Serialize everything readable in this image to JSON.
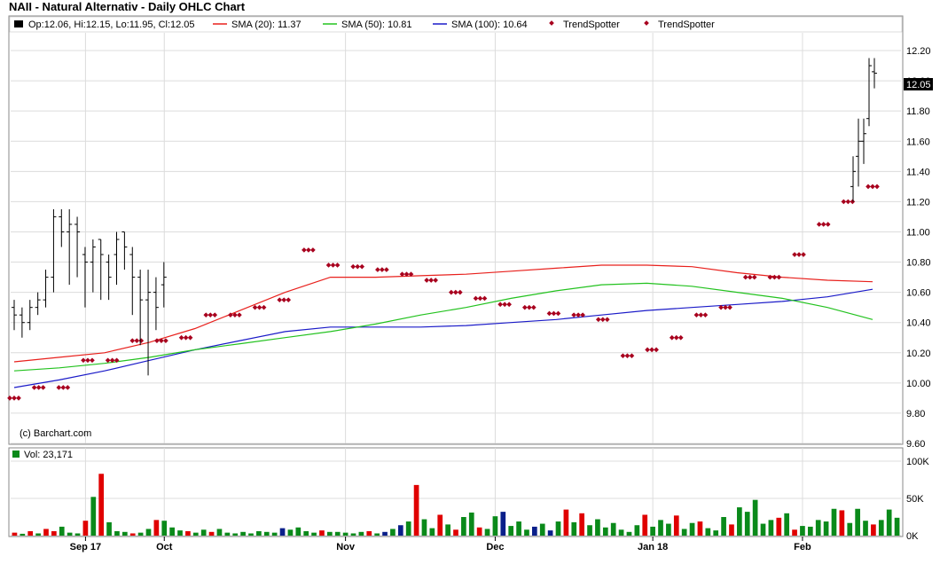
{
  "title": "NAII - Natural Alternativ - Daily OHLC Chart",
  "credit": "(c) Barchart.com",
  "colors": {
    "price_bar": "#000000",
    "sma20": "#e8201c",
    "sma50": "#23c21f",
    "sma100": "#1a1ac8",
    "trendspotter": "#a8001e",
    "vol_up": "#0a8a1a",
    "vol_down": "#e00000",
    "vol_neutral": "#0a1f8a",
    "grid": "#dcdcdc",
    "last_price_bg": "#000000"
  },
  "legend": {
    "ohlc": "Op:12.06, Hi:12.15, Lo:11.95, Cl:12.05",
    "sma20": "SMA (20): 11.37",
    "sma50": "SMA (50): 10.81",
    "sma100": "SMA (100): 10.64",
    "trend1": "TrendSpotter",
    "trend2": "TrendSpotter",
    "volume": "Vol: 23,171"
  },
  "last_price_label": "12.05",
  "chart_data": [
    {
      "type": "ohlc",
      "title": "NAII - Natural Alternativ - Daily OHLC Chart",
      "ylim": [
        9.6,
        12.3
      ],
      "y_ticks": [
        "12.20",
        "12.00",
        "11.80",
        "11.60",
        "11.40",
        "11.20",
        "11.00",
        "10.80",
        "10.60",
        "10.40",
        "10.20",
        "10.00",
        "9.80",
        "9.60"
      ],
      "x_ticks": [
        {
          "label": "Sep 17",
          "index": 9
        },
        {
          "label": "Oct",
          "index": 19
        },
        {
          "label": "Nov",
          "index": 42
        },
        {
          "label": "Dec",
          "index": 61
        },
        {
          "label": "Jan 18",
          "index": 81
        },
        {
          "label": "Feb",
          "index": 100
        }
      ],
      "ohlc": [
        [
          10.5,
          10.55,
          10.35,
          10.45
        ],
        [
          10.45,
          10.5,
          10.3,
          10.4
        ],
        [
          10.4,
          10.55,
          10.35,
          10.5
        ],
        [
          10.5,
          10.6,
          10.45,
          10.55
        ],
        [
          10.55,
          10.75,
          10.5,
          10.7
        ],
        [
          10.7,
          11.15,
          10.6,
          11.1
        ],
        [
          11.1,
          11.15,
          10.9,
          11.0
        ],
        [
          11.0,
          11.15,
          10.65,
          11.05
        ],
        [
          11.05,
          11.1,
          10.7,
          11.0
        ],
        [
          10.85,
          10.9,
          10.5,
          10.8
        ],
        [
          10.8,
          10.95,
          10.6,
          10.9
        ],
        [
          10.95,
          10.95,
          10.55,
          10.85
        ],
        [
          10.8,
          10.85,
          10.55,
          10.7
        ],
        [
          10.85,
          11.0,
          10.65,
          10.95
        ],
        [
          11.0,
          11.0,
          10.75,
          10.9
        ],
        [
          10.85,
          10.9,
          10.45,
          10.7
        ],
        [
          10.7,
          10.75,
          10.25,
          10.55
        ],
        [
          10.55,
          10.75,
          10.05,
          10.6
        ],
        [
          10.6,
          10.7,
          10.35,
          10.5
        ],
        [
          10.65,
          10.8,
          10.5,
          10.7
        ]
      ],
      "tail_ohlc": [
        [
          11.3,
          11.5,
          11.2,
          11.4
        ],
        [
          11.5,
          11.75,
          11.3,
          11.6
        ],
        [
          11.6,
          11.75,
          11.45,
          11.65
        ],
        [
          11.75,
          12.15,
          11.7,
          12.1
        ],
        [
          12.06,
          12.15,
          11.95,
          12.05
        ]
      ],
      "sma20": [
        10.14,
        10.17,
        10.2,
        10.27,
        10.36,
        10.48,
        10.6,
        10.7,
        10.7,
        10.71,
        10.72,
        10.74,
        10.76,
        10.78,
        10.78,
        10.77,
        10.73,
        10.7,
        10.68,
        10.67
      ],
      "sma50": [
        10.08,
        10.1,
        10.13,
        10.17,
        10.22,
        10.26,
        10.3,
        10.34,
        10.39,
        10.45,
        10.5,
        10.56,
        10.61,
        10.65,
        10.66,
        10.64,
        10.6,
        10.56,
        10.5,
        10.42
      ],
      "sma100": [
        9.97,
        10.02,
        10.08,
        10.15,
        10.22,
        10.28,
        10.34,
        10.37,
        10.37,
        10.37,
        10.38,
        10.4,
        10.42,
        10.45,
        10.48,
        10.5,
        10.52,
        10.54,
        10.57,
        10.62
      ],
      "trendspotter": [
        9.9,
        9.97,
        9.97,
        10.15,
        10.15,
        10.28,
        10.28,
        10.3,
        10.45,
        10.45,
        10.5,
        10.55,
        10.88,
        10.78,
        10.77,
        10.75,
        10.72,
        10.68,
        10.6,
        10.56,
        10.52,
        10.5,
        10.46,
        10.45,
        10.42,
        10.18,
        10.22,
        10.3,
        10.45,
        10.5,
        10.7,
        10.7,
        10.85,
        11.05,
        11.2,
        11.3
      ]
    },
    {
      "type": "bar",
      "title": "Vol: 23,171",
      "ylim": [
        0,
        100000
      ],
      "y_ticks": [
        "100K",
        "50K",
        "0K"
      ],
      "values": [
        4000,
        2500,
        6000,
        3000,
        9000,
        6000,
        12000,
        4000,
        3000,
        20000,
        52000,
        83000,
        18000,
        6000,
        5000,
        3000,
        4000,
        9000,
        21000,
        20000,
        11000,
        7000,
        6000,
        4000,
        8000,
        5000,
        9000,
        4000,
        3000,
        5000,
        3000,
        6000,
        5000,
        4000,
        10000,
        8000,
        11000,
        6000,
        4000,
        7000,
        5000,
        5000,
        4000,
        3000,
        5000,
        6000,
        3000,
        5000,
        9000,
        14000,
        19000,
        68000,
        22000,
        10000,
        28000,
        15000,
        8000,
        25000,
        31000,
        11000,
        9000,
        26000,
        32000,
        13000,
        19000,
        8000,
        12000,
        16000,
        7000,
        19000,
        35000,
        18000,
        30000,
        14000,
        22000,
        11000,
        17000,
        8000,
        5000,
        14000,
        28000,
        12000,
        21000,
        16000,
        27000,
        9000,
        17000,
        19000,
        10000,
        7000,
        25000,
        15000,
        38000,
        32000,
        48000,
        16000,
        21000,
        24000,
        30000,
        8000,
        13000,
        12000,
        21000,
        19000,
        36000,
        34000,
        17000,
        36000,
        20000,
        15000,
        21000,
        35000,
        24000
      ],
      "colors": [
        "d",
        "u",
        "d",
        "u",
        "d",
        "d",
        "u",
        "u",
        "u",
        "d",
        "u",
        "d",
        "u",
        "u",
        "u",
        "d",
        "u",
        "u",
        "d",
        "u",
        "u",
        "u",
        "d",
        "u",
        "u",
        "d",
        "u",
        "u",
        "u",
        "u",
        "u",
        "u",
        "u",
        "u",
        "n",
        "u",
        "u",
        "u",
        "u",
        "d",
        "u",
        "u",
        "u",
        "u",
        "u",
        "d",
        "u",
        "n",
        "u",
        "n",
        "u",
        "d",
        "u",
        "u",
        "d",
        "u",
        "d",
        "u",
        "u",
        "d",
        "u",
        "u",
        "n",
        "u",
        "u",
        "u",
        "n",
        "u",
        "n",
        "u",
        "d",
        "u",
        "d",
        "u",
        "u",
        "u",
        "u",
        "u",
        "u",
        "u",
        "d",
        "u",
        "u",
        "u",
        "d",
        "u",
        "u",
        "d",
        "u",
        "u",
        "u",
        "d",
        "u",
        "u",
        "u",
        "u",
        "u",
        "d",
        "u",
        "d",
        "u",
        "u",
        "u",
        "u",
        "u",
        "d",
        "u",
        "u",
        "u",
        "d",
        "u",
        "u",
        "u"
      ]
    }
  ]
}
